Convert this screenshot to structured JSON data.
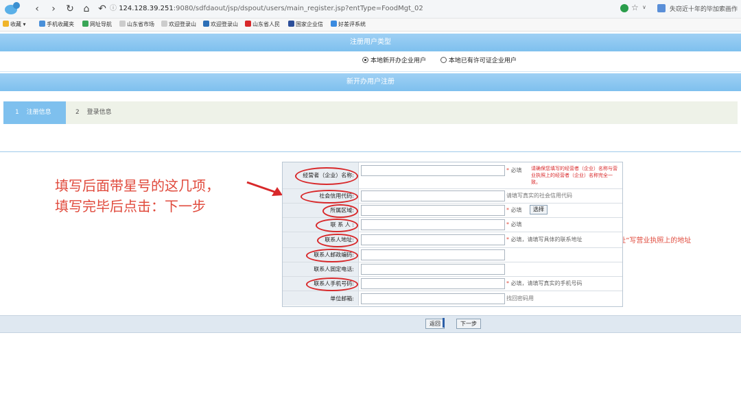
{
  "browser": {
    "url_host": "124.128.39.251",
    "url_path": ":9080/sdfdaout/jsp/dspout/users/main_register.jsp?entType=FoodMgt_02",
    "right_tab_text": "失窃近十年的毕加索画作",
    "bookmarks": [
      "收藏",
      "手机收藏夹",
      "网址导航",
      "山东省市场",
      "欢迎登录山",
      "欢迎登录山",
      "山东省人民",
      "国家企业信",
      "好差评系统"
    ]
  },
  "page": {
    "user_type_title": "注册用户类型",
    "radio_options": [
      "本地新开办企业用户",
      "本地已有许可证企业用户"
    ],
    "register_title": "新开办用户注册",
    "steps": [
      {
        "num": "1",
        "label": "注册信息"
      },
      {
        "num": "2",
        "label": "登录信息"
      }
    ]
  },
  "annotation": {
    "note_line1": "填写后面带星号的这几项，",
    "note_line2": "填写完毕后点击：下一步",
    "address_note": "“联系地址”写营业执照上的地址"
  },
  "form": {
    "fields": [
      {
        "label": "经营者（企业）名称:",
        "required": "必填",
        "hint": ""
      },
      {
        "label": "社会信用代码:",
        "required": "",
        "hint": "请填写真实的社会信用代码"
      },
      {
        "label": "所属区域:",
        "required": "必填",
        "hint": ""
      },
      {
        "label": "联 系 人 :",
        "required": "必填",
        "hint": ""
      },
      {
        "label": "联系人地址:",
        "required": "必填，请填写具体的联系地址",
        "hint": ""
      },
      {
        "label": "联系人邮政编码:",
        "required": "",
        "hint": ""
      },
      {
        "label": "联系人固定电话:",
        "required": "",
        "hint": ""
      },
      {
        "label": "联系人手机号码:",
        "required": "必填，请填写真实的手机号码",
        "hint": ""
      },
      {
        "label": "单位邮箱:",
        "required": "",
        "hint": "找回密码用"
      }
    ],
    "warning": "请确保您填写的经营者（企业）名称与营业执照上的经营者（企业）名称完全一致。",
    "choose_button": "选择",
    "back_button": "返回",
    "next_button": "下一步"
  }
}
